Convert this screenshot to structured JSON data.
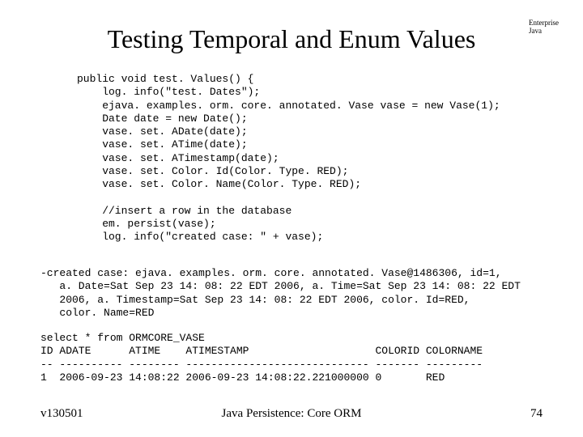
{
  "corner": {
    "line1": "Enterprise",
    "line2": "Java"
  },
  "title": "Testing Temporal and Enum Values",
  "code": {
    "block1": "public void test. Values() {\n    log. info(\"test. Dates\");\n    ejava. examples. orm. core. annotated. Vase vase = new Vase(1);\n    Date date = new Date();\n    vase. set. ADate(date);\n    vase. set. ATime(date);\n    vase. set. ATimestamp(date);\n    vase. set. Color. Id(Color. Type. RED);\n    vase. set. Color. Name(Color. Type. RED);\n\n    //insert a row in the database\n    em. persist(vase);\n    log. info(\"created case: \" + vase);",
    "block2": "-created case: ejava. examples. orm. core. annotated. Vase@1486306, id=1,\n   a. Date=Sat Sep 23 14: 08: 22 EDT 2006, a. Time=Sat Sep 23 14: 08: 22 EDT\n   2006, a. Timestamp=Sat Sep 23 14: 08: 22 EDT 2006, color. Id=RED,\n   color. Name=RED",
    "block3": "select * from ORMCORE_VASE\nID ADATE      ATIME    ATIMESTAMP                    COLORID COLORNAME\n-- ---------- -------- ----------------------------- ------- ---------\n1  2006-09-23 14:08:22 2006-09-23 14:08:22.221000000 0       RED"
  },
  "footer": {
    "left": "v130501",
    "center": "Java Persistence: Core ORM",
    "right": "74"
  }
}
